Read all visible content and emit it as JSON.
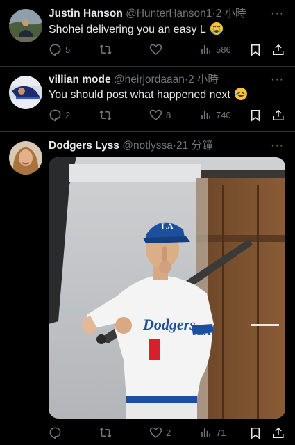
{
  "tweets": [
    {
      "name": "Justin Hanson",
      "handle": "@HunterHanson1",
      "sep": "·",
      "time": "2 小時",
      "text": "Shohei delivering you an easy L",
      "replies": "5",
      "retweets": "",
      "likes": "",
      "views": "586"
    },
    {
      "name": "villian mode",
      "handle": "@heirjordaaan",
      "sep": "·",
      "time": "2 小時",
      "text": "You should post what happened next",
      "replies": "2",
      "retweets": "",
      "likes": "8",
      "views": "740"
    },
    {
      "name": "Dodgers Lyss",
      "handle": "@notlyssa",
      "sep": "·",
      "time": "21 分鐘",
      "text": "",
      "replies": "",
      "retweets": "",
      "likes": "2",
      "views": "71"
    }
  ],
  "more_label": "···",
  "photo": {
    "jersey_script": "Dodgers",
    "cap_logo": "LA",
    "sleeve_logo": "LA"
  },
  "icons": {
    "reply": "reply-icon",
    "retweet": "retweet-icon",
    "like": "heart-icon",
    "views": "views-icon",
    "bookmark": "bookmark-icon",
    "share": "share-icon",
    "more": "more-icon"
  },
  "colors": {
    "background": "#000000",
    "text": "#e7e9ea",
    "muted": "#71767b",
    "divider": "#2f3336",
    "dodger_blue": "#1d4f9f"
  }
}
